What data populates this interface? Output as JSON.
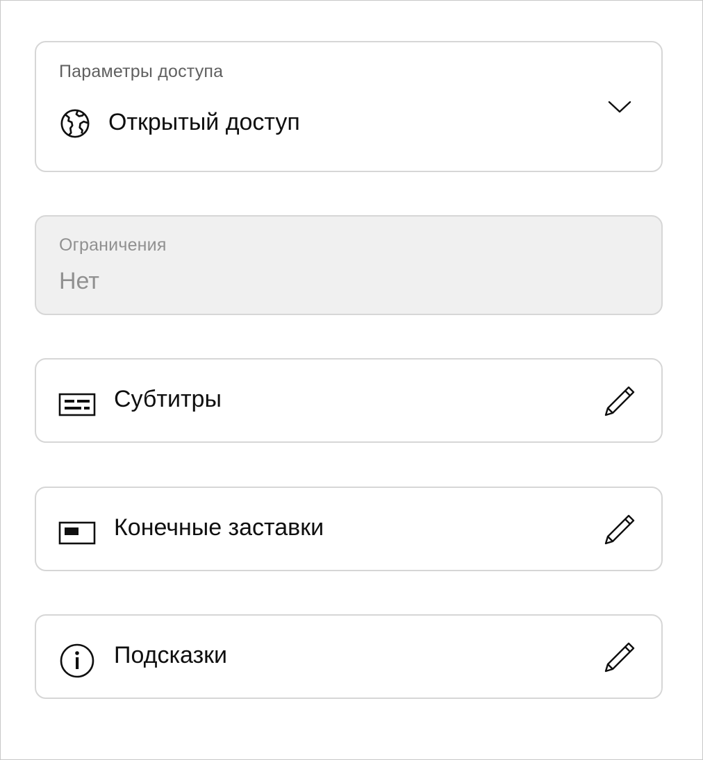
{
  "access": {
    "label": "Параметры доступа",
    "value": "Открытый доступ",
    "icon": "globe-icon"
  },
  "restrictions": {
    "label": "Ограничения",
    "value": "Нет"
  },
  "rows": [
    {
      "label": "Субтитры",
      "icon": "subtitles-icon",
      "action_icon": "pencil-icon"
    },
    {
      "label": "Конечные заставки",
      "icon": "end-screen-icon",
      "action_icon": "pencil-icon"
    },
    {
      "label": "Подсказки",
      "icon": "info-icon",
      "action_icon": "pencil-icon"
    }
  ],
  "colors": {
    "text_primary": "#0f0f0f",
    "text_secondary": "#606060",
    "text_disabled": "#909090",
    "border": "#d6d6d6",
    "disabled_bg": "#f0f0f0"
  }
}
